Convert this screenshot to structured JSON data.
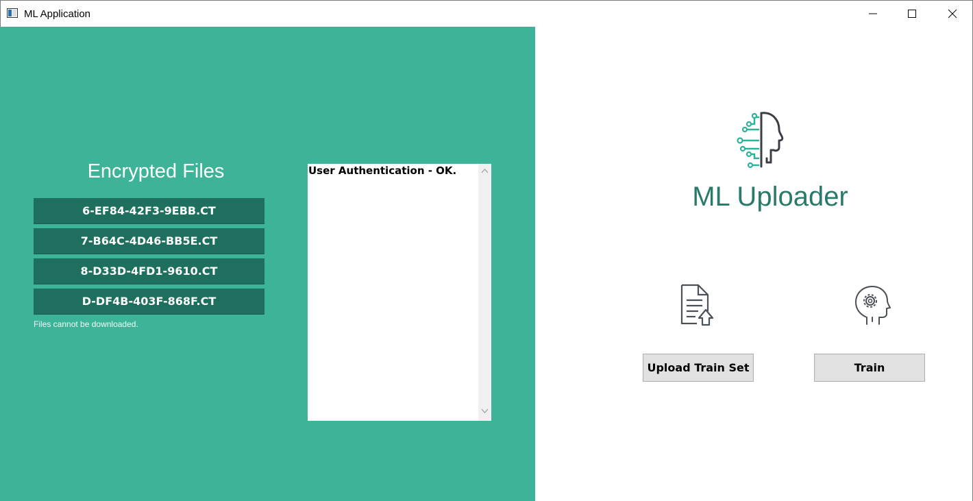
{
  "window": {
    "title": "ML Application"
  },
  "left": {
    "heading": "Encrypted Files",
    "files": [
      "6-EF84-42F3-9EBB.CT",
      "7-B64C-4D46-BB5E.CT",
      "8-D33D-4FD1-9610.CT",
      "D-DF4B-403F-868F.CT"
    ],
    "note": "Files cannot be downloaded.",
    "log": "User Authentication - OK."
  },
  "right": {
    "app_name": "ML Uploader",
    "upload_label": "Upload Train Set",
    "train_label": "Train"
  },
  "colors": {
    "panel": "#3db497",
    "file_button": "#1f6f5e",
    "accent": "#2a7a6a"
  }
}
